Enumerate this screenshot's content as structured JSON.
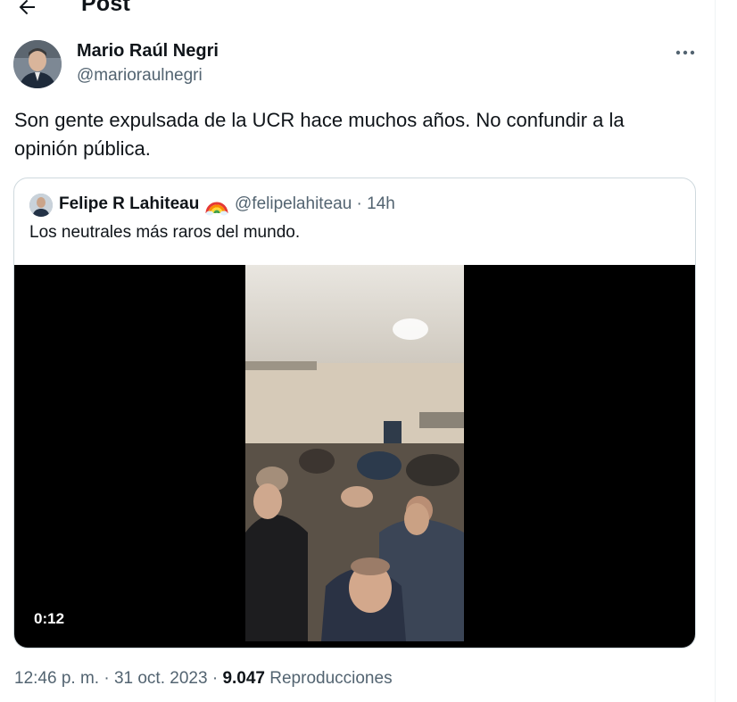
{
  "header": {
    "title": "Post",
    "back_icon": "arrow-left-icon"
  },
  "author": {
    "name": "Mario Raúl Negri",
    "handle": "@marioraulnegri"
  },
  "more_icon": "more-horizontal-icon",
  "post": {
    "text": "Son gente expulsada de la UCR hace muchos años. No confundir a la opinión pública."
  },
  "quoted": {
    "name": "Felipe R Lahiteau",
    "emoji": "rainbow-emoji",
    "handle": "@felipelahiteau",
    "time": "14h",
    "text": "Los neutrales más raros del mundo.",
    "video": {
      "duration": "0:12"
    }
  },
  "meta": {
    "time": "12:46 p. m.",
    "date": "31 oct. 2023",
    "views_count": "9.047",
    "views_label": "Reproducciones"
  },
  "colors": {
    "text": "#0f1419",
    "secondary": "#536471",
    "border": "#cfd9de"
  }
}
